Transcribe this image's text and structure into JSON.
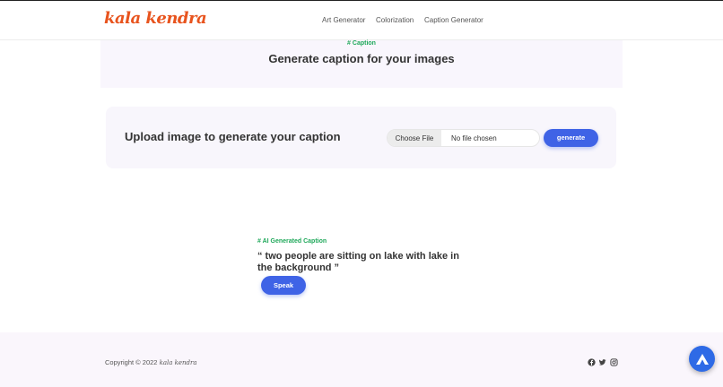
{
  "header": {
    "logo_text": "kala kendra",
    "nav": [
      "Art Generator",
      "Colorization",
      "Caption Generator"
    ]
  },
  "hero": {
    "tag": "# Caption",
    "title": "Generate caption for your images"
  },
  "upload": {
    "title": "Upload image to generate your caption",
    "file_button": "Choose File",
    "file_status": "No file chosen",
    "generate_label": "generate"
  },
  "result": {
    "tag": "# AI Generated Caption",
    "caption": "“ two people are sitting on lake with lake in the background ”",
    "speak_label": "Speak"
  },
  "footer": {
    "copyright_prefix": "Copyright © 2022",
    "brand": "kala kendra",
    "social_icons": [
      "facebook-icon",
      "twitter-icon",
      "instagram-icon"
    ]
  },
  "colors": {
    "brand_orange": "#e8541e",
    "accent_blue": "#3f63e6",
    "tag_green": "#1fa85a",
    "fab_blue": "#2e6ae6"
  }
}
